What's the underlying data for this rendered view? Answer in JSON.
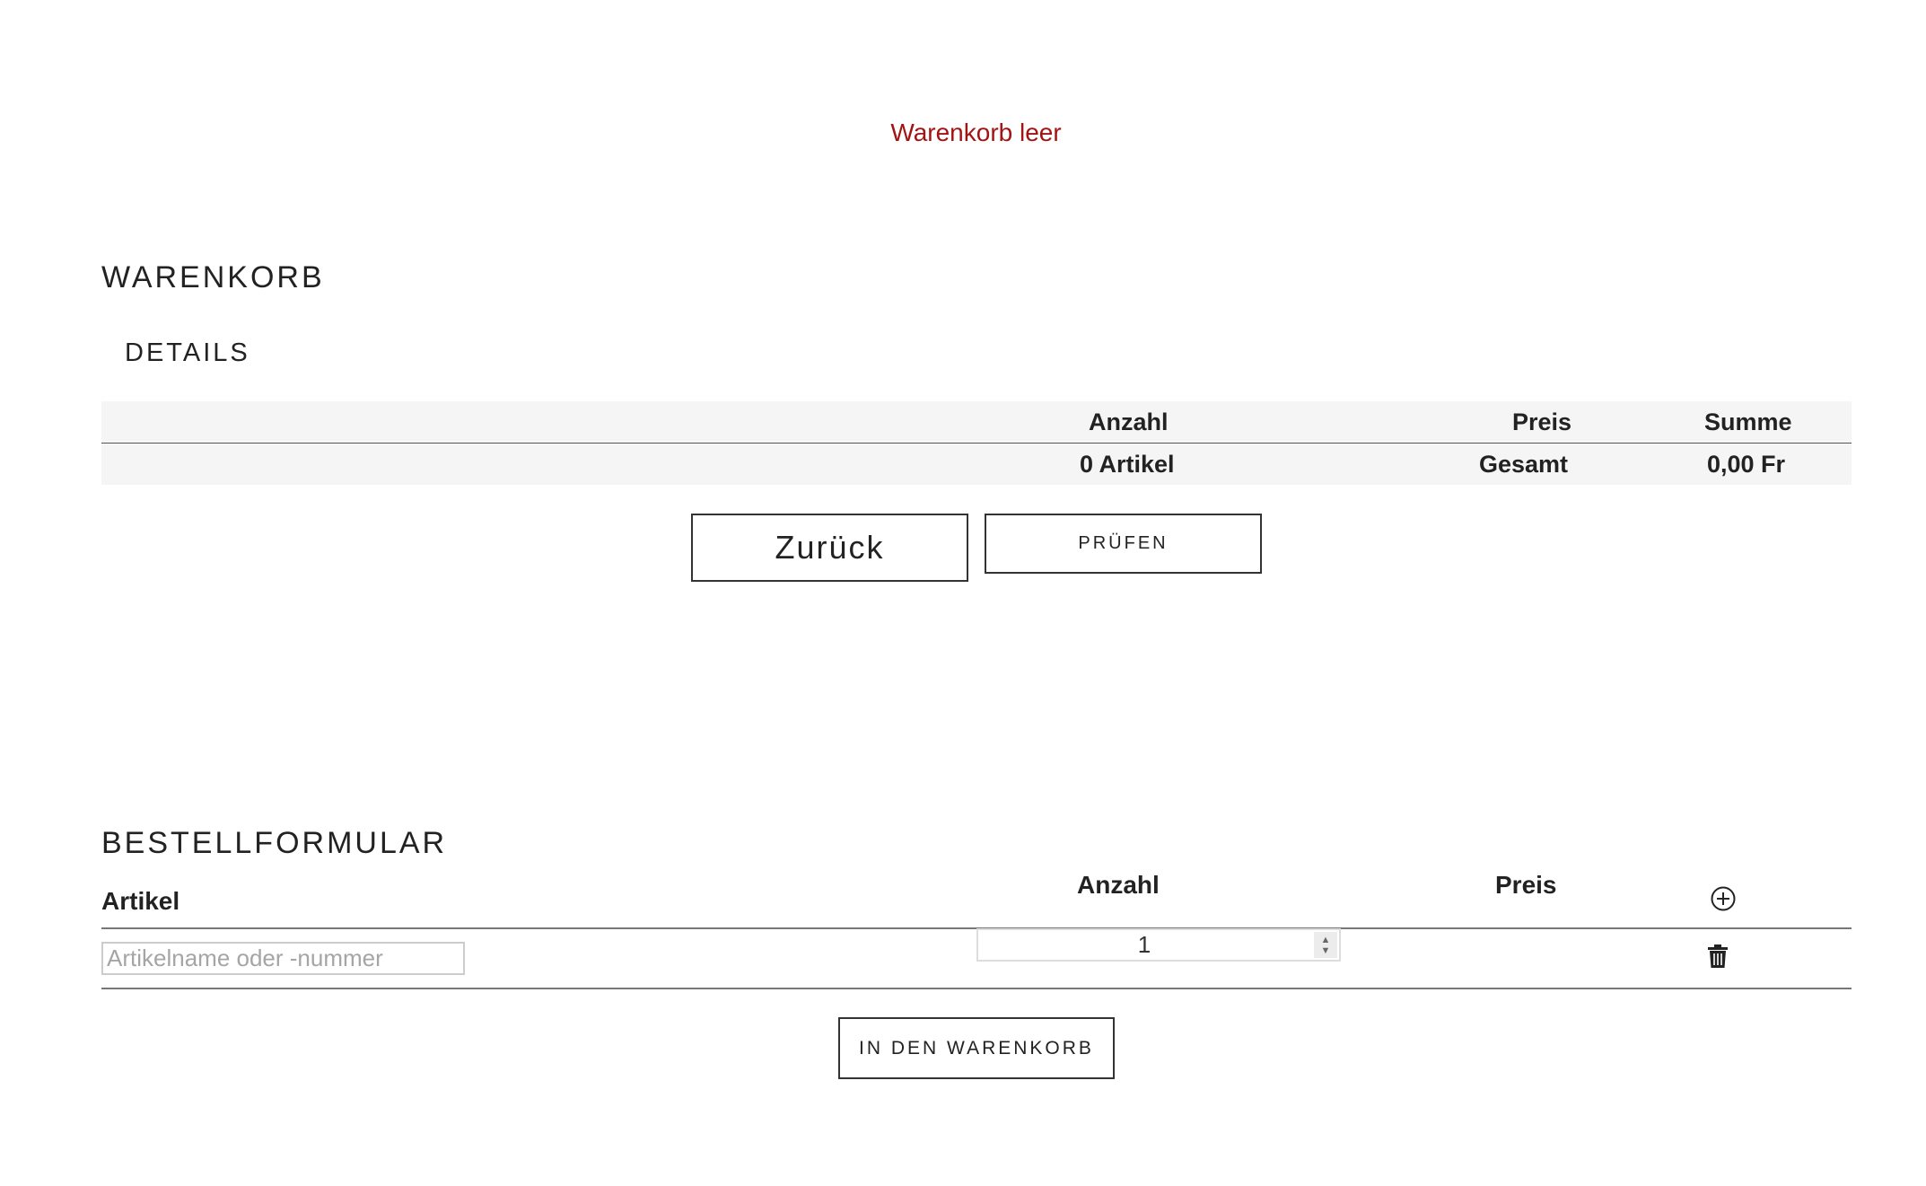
{
  "notice": "Warenkorb leer",
  "cart": {
    "title": "WARENKORB",
    "details_title": "DETAILS",
    "columns": {
      "quantity": "Anzahl",
      "price": "Preis",
      "sum": "Summe"
    },
    "footer": {
      "count": "0 Artikel",
      "total_label": "Gesamt",
      "total_value": "0,00 Fr"
    },
    "back_button": "Zurück",
    "check_button": "PRÜFEN"
  },
  "order_form": {
    "title": "BESTELLFORMULAR",
    "columns": {
      "article": "Artikel",
      "quantity": "Anzahl",
      "price": "Preis"
    },
    "row": {
      "article_placeholder": "Artikelname oder -nummer",
      "quantity": "1"
    },
    "add_to_cart_button": "IN DEN WARENKORB"
  },
  "icons": {
    "add_row": "plus-circle-icon",
    "delete_row": "trash-icon"
  },
  "colors": {
    "notice": "#a31313",
    "table_bg": "#f5f5f5"
  }
}
